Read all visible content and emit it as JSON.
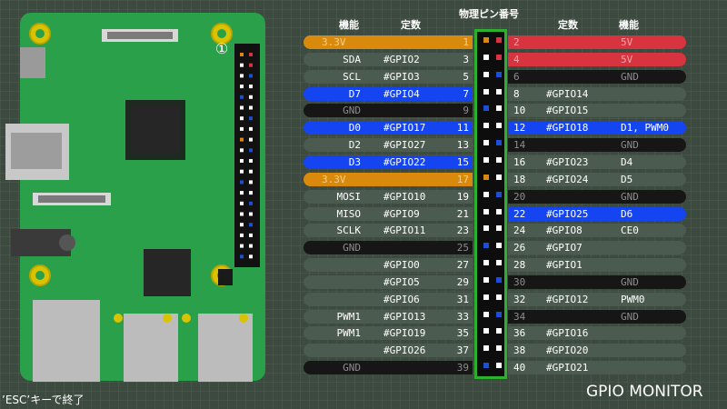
{
  "colors": {
    "power_3v3": "#d98a0c",
    "power_5v": "#d8343f",
    "ground": "#161616",
    "gpio": "#4c5b4f",
    "active": "#1545f0",
    "header_border": "#2cb12c",
    "pcb": "#2aa04a"
  },
  "header": {
    "col_function": "機能",
    "col_name": "定数",
    "col_pin": "物理ピン番号"
  },
  "board": {
    "pin1_marker": "①"
  },
  "left_pins": [
    {
      "num": "1",
      "gpio": "",
      "func": "3.3V",
      "kind": "power33"
    },
    {
      "num": "3",
      "gpio": "#GPIO2",
      "func": "SDA",
      "kind": "gpio"
    },
    {
      "num": "5",
      "gpio": "#GPIO3",
      "func": "SCL",
      "kind": "gpio"
    },
    {
      "num": "7",
      "gpio": "#GPIO4",
      "func": "D7",
      "kind": "active"
    },
    {
      "num": "9",
      "gpio": "",
      "func": "GND",
      "kind": "gnd"
    },
    {
      "num": "11",
      "gpio": "#GPIO17",
      "func": "D0",
      "kind": "active"
    },
    {
      "num": "13",
      "gpio": "#GPIO27",
      "func": "D2",
      "kind": "gpio"
    },
    {
      "num": "15",
      "gpio": "#GPIO22",
      "func": "D3",
      "kind": "active"
    },
    {
      "num": "17",
      "gpio": "",
      "func": "3.3V",
      "kind": "power33"
    },
    {
      "num": "19",
      "gpio": "#GPIO10",
      "func": "MOSI",
      "kind": "gpio"
    },
    {
      "num": "21",
      "gpio": "#GPIO9",
      "func": "MISO",
      "kind": "gpio"
    },
    {
      "num": "23",
      "gpio": "#GPIO11",
      "func": "SCLK",
      "kind": "gpio"
    },
    {
      "num": "25",
      "gpio": "",
      "func": "GND",
      "kind": "gnd"
    },
    {
      "num": "27",
      "gpio": "#GPIO0",
      "func": "",
      "kind": "gpio"
    },
    {
      "num": "29",
      "gpio": "#GPIO5",
      "func": "",
      "kind": "gpio"
    },
    {
      "num": "31",
      "gpio": "#GPIO6",
      "func": "",
      "kind": "gpio"
    },
    {
      "num": "33",
      "gpio": "#GPIO13",
      "func": "PWM1",
      "kind": "gpio"
    },
    {
      "num": "35",
      "gpio": "#GPIO19",
      "func": "PWM1",
      "kind": "gpio"
    },
    {
      "num": "37",
      "gpio": "#GPIO26",
      "func": "",
      "kind": "gpio"
    },
    {
      "num": "39",
      "gpio": "",
      "func": "GND",
      "kind": "gnd"
    }
  ],
  "right_pins": [
    {
      "num": "2",
      "gpio": "",
      "func": "5V",
      "kind": "power5"
    },
    {
      "num": "4",
      "gpio": "",
      "func": "5V",
      "kind": "power5"
    },
    {
      "num": "6",
      "gpio": "",
      "func": "GND",
      "kind": "gnd"
    },
    {
      "num": "8",
      "gpio": "#GPIO14",
      "func": "",
      "kind": "gpio"
    },
    {
      "num": "10",
      "gpio": "#GPIO15",
      "func": "",
      "kind": "gpio"
    },
    {
      "num": "12",
      "gpio": "#GPIO18",
      "func": "D1, PWM0",
      "kind": "active"
    },
    {
      "num": "14",
      "gpio": "",
      "func": "GND",
      "kind": "gnd"
    },
    {
      "num": "16",
      "gpio": "#GPIO23",
      "func": "D4",
      "kind": "gpio"
    },
    {
      "num": "18",
      "gpio": "#GPIO24",
      "func": "D5",
      "kind": "gpio"
    },
    {
      "num": "20",
      "gpio": "",
      "func": "GND",
      "kind": "gnd"
    },
    {
      "num": "22",
      "gpio": "#GPIO25",
      "func": "D6",
      "kind": "active"
    },
    {
      "num": "24",
      "gpio": "#GPIO8",
      "func": "CE0",
      "kind": "gpio"
    },
    {
      "num": "26",
      "gpio": "#GPIO7",
      "func": "",
      "kind": "gpio"
    },
    {
      "num": "28",
      "gpio": "#GPIO1",
      "func": "",
      "kind": "gpio"
    },
    {
      "num": "30",
      "gpio": "",
      "func": "GND",
      "kind": "gnd"
    },
    {
      "num": "32",
      "gpio": "#GPIO12",
      "func": "PWM0",
      "kind": "gpio"
    },
    {
      "num": "34",
      "gpio": "",
      "func": "GND",
      "kind": "gnd"
    },
    {
      "num": "36",
      "gpio": "#GPIO16",
      "func": "",
      "kind": "gpio"
    },
    {
      "num": "38",
      "gpio": "#GPIO20",
      "func": "",
      "kind": "gpio"
    },
    {
      "num": "40",
      "gpio": "#GPIO21",
      "func": "",
      "kind": "gpio"
    }
  ],
  "footer": {
    "esc_hint": "’ESC’キーで終了",
    "title": "GPIO MONITOR"
  }
}
